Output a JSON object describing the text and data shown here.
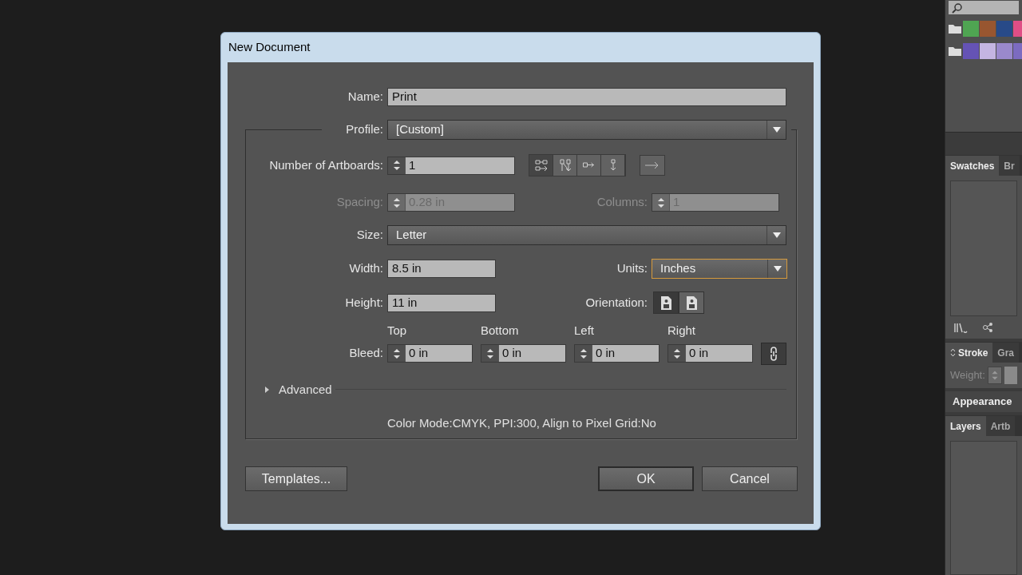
{
  "dialog": {
    "title": "New Document",
    "name": {
      "label": "Name:",
      "value": "Print"
    },
    "profile": {
      "label": "Profile:",
      "value": "[Custom]"
    },
    "artboards": {
      "label": "Number of Artboards:",
      "value": "1",
      "arrangements": [
        {
          "selected": true
        },
        {
          "selected": false
        },
        {
          "selected": false
        },
        {
          "selected": false
        }
      ]
    },
    "spacing": {
      "label": "Spacing:",
      "value": "0.28 in",
      "disabled": true
    },
    "columns": {
      "label": "Columns:",
      "value": "1",
      "disabled": true
    },
    "size": {
      "label": "Size:",
      "value": "Letter"
    },
    "width": {
      "label": "Width:",
      "value": "8.5 in"
    },
    "units": {
      "label": "Units:",
      "value": "Inches",
      "focused": true
    },
    "height": {
      "label": "Height:",
      "value": "11 in"
    },
    "orientation": {
      "label": "Orientation:",
      "options": [
        {
          "selected": true
        },
        {
          "selected": false
        }
      ]
    },
    "bleed": {
      "label": "Bleed:",
      "linked": true,
      "sides": [
        {
          "label": "Top",
          "value": "0 in"
        },
        {
          "label": "Bottom",
          "value": "0 in"
        },
        {
          "label": "Left",
          "value": "0 in"
        },
        {
          "label": "Right",
          "value": "0 in"
        }
      ]
    },
    "advanced": {
      "label": "Advanced",
      "expanded": false
    },
    "summary": "Color Mode:CMYK, PPI:300, Align to Pixel Grid:No",
    "buttons": [
      {
        "label": "Templates...",
        "default": false
      },
      {
        "label": "OK",
        "default": true
      },
      {
        "label": "Cancel",
        "default": false
      }
    ]
  },
  "side_panel": {
    "swatch_groups": [
      {
        "colors": [
          {
            "color": "#4fa552"
          },
          {
            "color": "#985630"
          },
          {
            "color": "#284a88"
          },
          {
            "color": "#e04e86"
          }
        ]
      },
      {
        "colors": [
          {
            "color": "#6553b5"
          },
          {
            "color": "#c4b5e2"
          },
          {
            "color": "#9a89cc"
          },
          {
            "color": "#7c6bc0"
          }
        ]
      }
    ],
    "swatches_tabs": [
      {
        "label": "Swatches",
        "selected": true
      },
      {
        "label": "Br",
        "selected": false
      }
    ],
    "stroke_tabs": [
      {
        "label": "Stroke",
        "selected": true
      },
      {
        "label": "Gra",
        "selected": false
      }
    ],
    "weight_label": "Weight:",
    "appearance_tab": "Appearance",
    "layers_tabs": [
      {
        "label": "Layers",
        "selected": true
      },
      {
        "label": "Artb",
        "selected": false
      }
    ]
  }
}
